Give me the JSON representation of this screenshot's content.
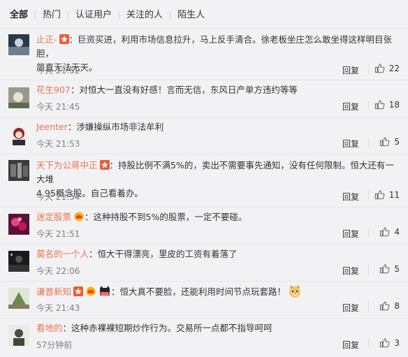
{
  "tabs": [
    "全部",
    "热门",
    "认证用户",
    "关注的人",
    "陌生人"
  ],
  "actions": {
    "reply_label": "回复"
  },
  "colors": {
    "username": "#eb7350",
    "time": "#808080",
    "background": "#f2f2f5"
  },
  "comments": [
    {
      "user": "止正-",
      "badges": [
        "star-icon"
      ],
      "text": "：巨资买进，利用市场信息拉升，马上反手清合。徐老板坐庄怎么敢坐得这样明目张胆，",
      "text2": "简直无法无天。",
      "time": "今天 21:52",
      "likes": "22"
    },
    {
      "user": "花生907",
      "badges": [],
      "text": "：对恒大一直没有好感！言而无信，东风日产单方违约等等",
      "text2": "",
      "time": "今天 21:45",
      "likes": "18"
    },
    {
      "user": "Jeenter",
      "badges": [],
      "text": "：涉嫌操纵市场非法牟利",
      "text2": "",
      "time": "今天 21:53",
      "likes": "5"
    },
    {
      "user": "天下为公蒋中正",
      "badges": [
        "star-icon"
      ],
      "text": "：持股比例不满5%的，卖出不需要事先通知，没有任何限制。恒大还有一大堆",
      "text2": "4.95概念股。自己看着办。",
      "time": "今天 21:54",
      "likes": "11"
    },
    {
      "user": "迷定股票",
      "badges": [
        "crown-icon"
      ],
      "text": "：这种持股不到5%的股票，一定不要碰。",
      "text2": "",
      "time": "今天 21:51",
      "likes": "4"
    },
    {
      "user": "莫名的一个人",
      "badges": [],
      "text": "：恒大干得漂亮，里皮的工资有着落了",
      "text2": "",
      "time": "今天 22:06",
      "likes": "5"
    },
    {
      "user": "谦普新知",
      "badges": [
        "star-icon",
        "crown-icon",
        "cat-icon"
      ],
      "text": "：恒大真不要脸，还能利用时间节点玩套路！",
      "text2": "",
      "time": "今天 21:43",
      "likes": "8",
      "emoji": "doge-emoji-icon"
    },
    {
      "user": "看地的",
      "badges": [],
      "text": "：这种赤裸裸短期炒作行为。交易所一点都不指导呵呵",
      "text2": "",
      "time": "57分钟前",
      "likes": "3"
    }
  ],
  "badge_labels": {
    "cat_level": "1111"
  }
}
